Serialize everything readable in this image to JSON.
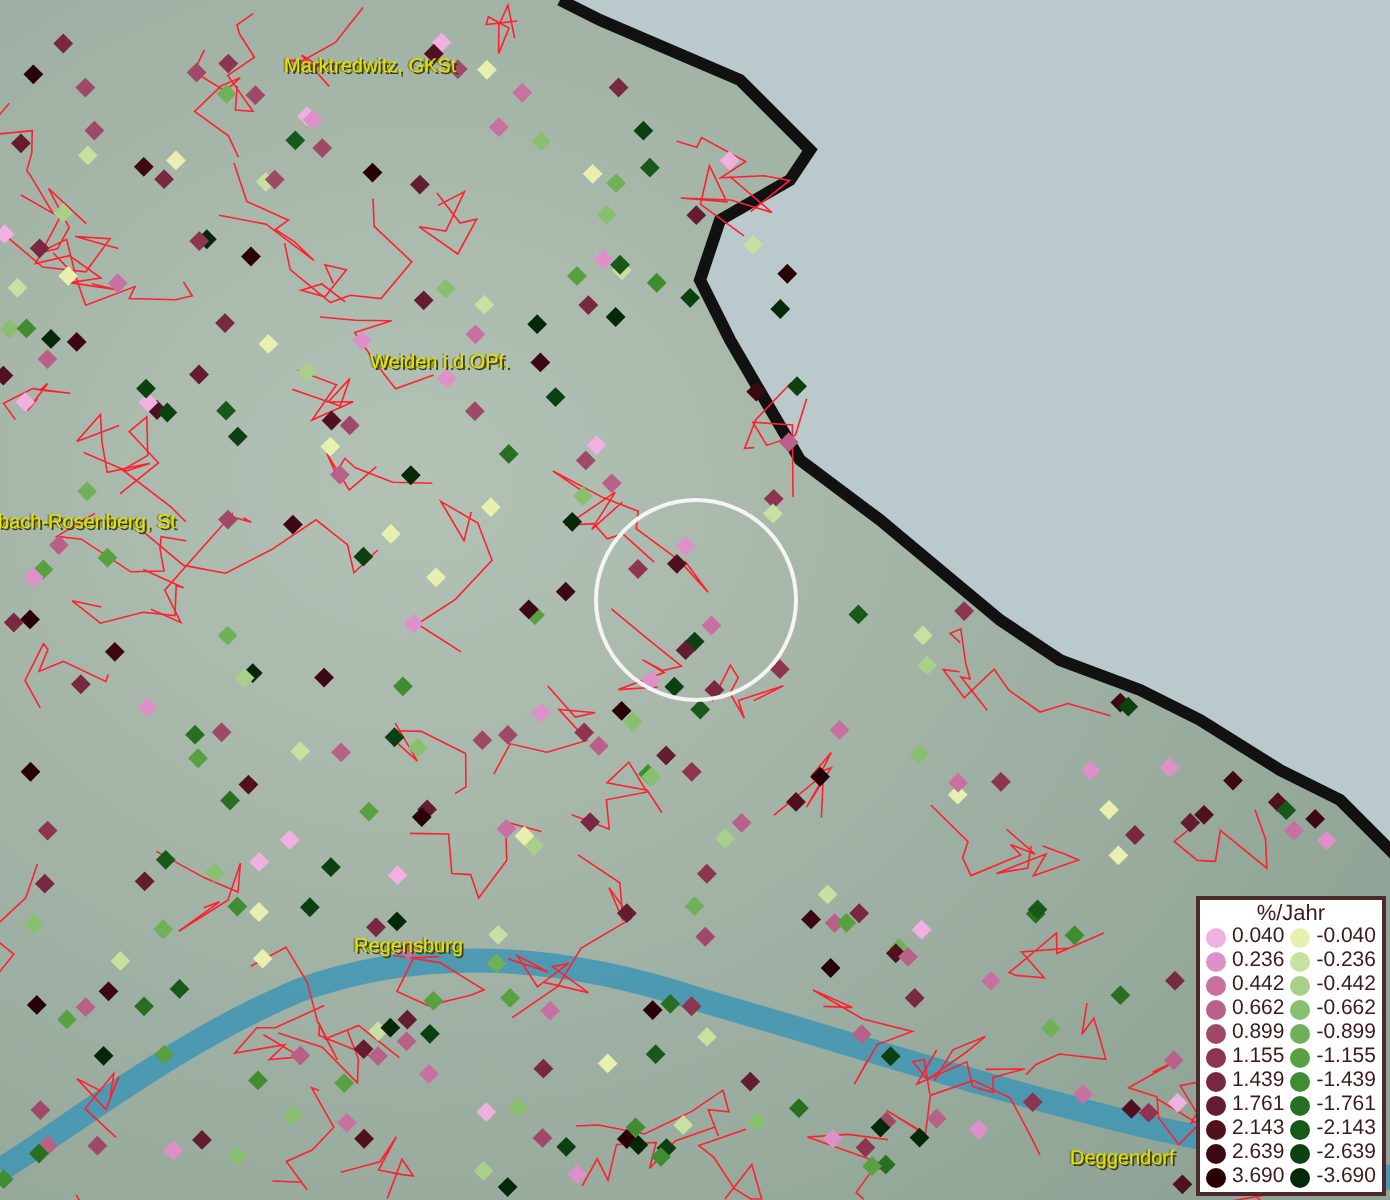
{
  "places": [
    {
      "name": "Marktredwitz, GKSt"
    },
    {
      "name": "Weiden i.d.OPf."
    },
    {
      "name": "bach-Rosenberg, St"
    },
    {
      "name": "Regensburg"
    },
    {
      "name": "Deggendorf"
    }
  ],
  "legend": {
    "title": "%/Jahr",
    "positive": [
      {
        "value": "0.040",
        "color": "#f0b0e0"
      },
      {
        "value": "0.236",
        "color": "#e090c8"
      },
      {
        "value": "0.442",
        "color": "#c870a0"
      },
      {
        "value": "0.662",
        "color": "#b86088"
      },
      {
        "value": "0.899",
        "color": "#a04868"
      },
      {
        "value": "1.155",
        "color": "#8c3450"
      },
      {
        "value": "1.439",
        "color": "#782840"
      },
      {
        "value": "1.761",
        "color": "#641c30"
      },
      {
        "value": "2.143",
        "color": "#501020"
      },
      {
        "value": "2.639",
        "color": "#3c0814"
      },
      {
        "value": "3.690",
        "color": "#280008"
      }
    ],
    "negative": [
      {
        "value": "-0.040",
        "color": "#e8f0b0"
      },
      {
        "value": "-0.236",
        "color": "#c8e0a0"
      },
      {
        "value": "-0.442",
        "color": "#a8d088"
      },
      {
        "value": "-0.662",
        "color": "#88c070"
      },
      {
        "value": "-0.899",
        "color": "#70b058"
      },
      {
        "value": "-1.155",
        "color": "#58a040"
      },
      {
        "value": "-1.439",
        "color": "#408c30"
      },
      {
        "value": "-1.761",
        "color": "#287020"
      },
      {
        "value": "-2.143",
        "color": "#185818"
      },
      {
        "value": "-2.639",
        "color": "#0c4010"
      },
      {
        "value": "-3.690",
        "color": "#042808"
      }
    ]
  }
}
